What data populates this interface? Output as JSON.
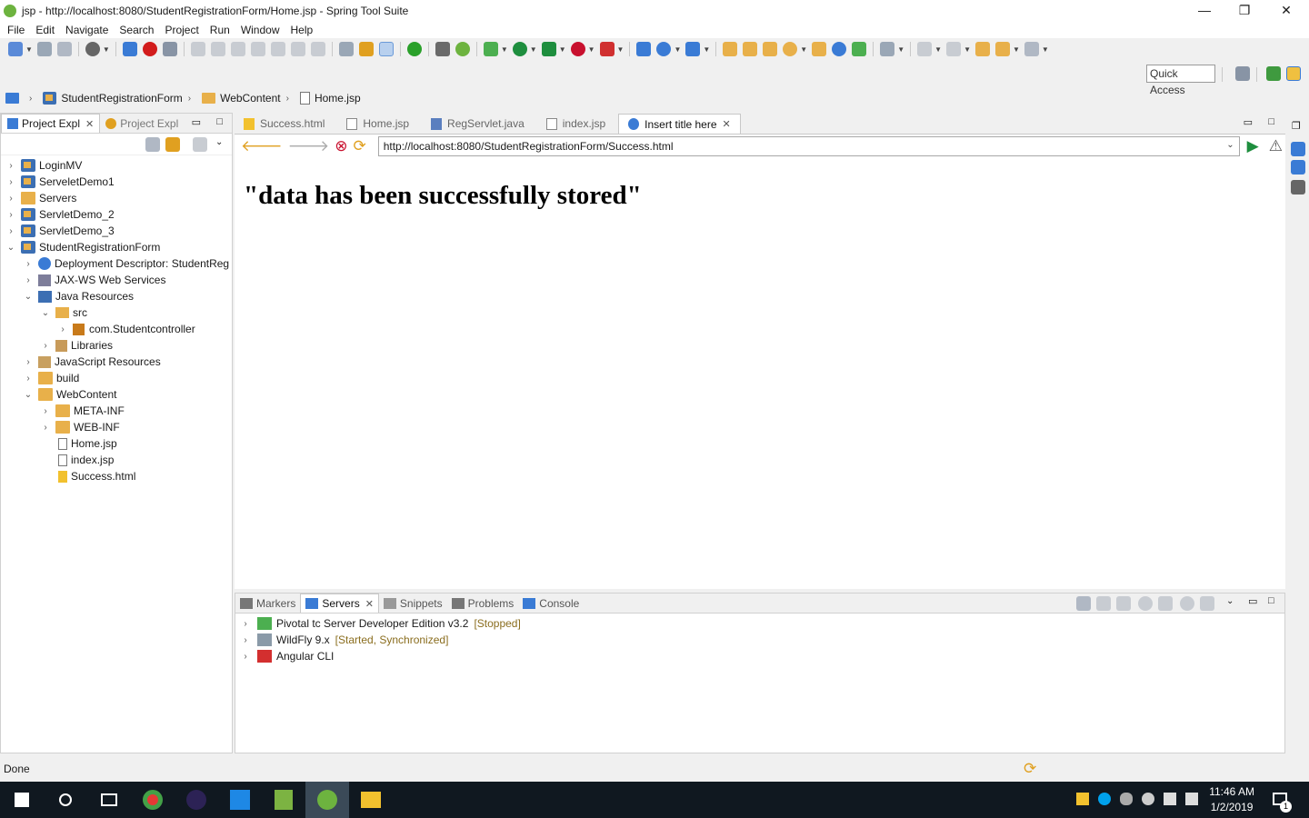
{
  "window": {
    "title": "jsp - http://localhost:8080/StudentRegistrationForm/Home.jsp - Spring Tool Suite",
    "minimize": "—",
    "restore": "❐",
    "close": "✕"
  },
  "menu": [
    "File",
    "Edit",
    "Navigate",
    "Search",
    "Project",
    "Run",
    "Window",
    "Help"
  ],
  "quick_access": "Quick Access",
  "breadcrumb": [
    "StudentRegistrationForm",
    "WebContent",
    "Home.jsp"
  ],
  "left_panel": {
    "tabs": [
      {
        "label": "Project Expl",
        "active": true
      },
      {
        "label": "Project Expl",
        "active": false
      }
    ],
    "tree": [
      {
        "label": "LoginMV",
        "indent": 0,
        "twisty": "›",
        "icon": "proj"
      },
      {
        "label": "ServeletDemo1",
        "indent": 0,
        "twisty": "›",
        "icon": "proj"
      },
      {
        "label": "Servers",
        "indent": 0,
        "twisty": "›",
        "icon": "fold"
      },
      {
        "label": "ServletDemo_2",
        "indent": 0,
        "twisty": "›",
        "icon": "proj"
      },
      {
        "label": "ServletDemo_3",
        "indent": 0,
        "twisty": "›",
        "icon": "proj"
      },
      {
        "label": "StudentRegistrationForm",
        "indent": 0,
        "twisty": "⌄",
        "icon": "proj"
      },
      {
        "label": "Deployment Descriptor: StudentReg",
        "indent": 1,
        "twisty": "›",
        "icon": "globe"
      },
      {
        "label": "JAX-WS Web Services",
        "indent": 1,
        "twisty": "›",
        "icon": "ws"
      },
      {
        "label": "Java Resources",
        "indent": 1,
        "twisty": "⌄",
        "icon": "jres"
      },
      {
        "label": "src",
        "indent": 2,
        "twisty": "⌄",
        "icon": "srcf"
      },
      {
        "label": "com.Studentcontroller",
        "indent": 3,
        "twisty": "›",
        "icon": "pkg"
      },
      {
        "label": "Libraries",
        "indent": 2,
        "twisty": "›",
        "icon": "lib"
      },
      {
        "label": "JavaScript Resources",
        "indent": 1,
        "twisty": "›",
        "icon": "jsr"
      },
      {
        "label": "build",
        "indent": 1,
        "twisty": "›",
        "icon": "fold"
      },
      {
        "label": "WebContent",
        "indent": 1,
        "twisty": "⌄",
        "icon": "fold"
      },
      {
        "label": "META-INF",
        "indent": 2,
        "twisty": "›",
        "icon": "fold"
      },
      {
        "label": "WEB-INF",
        "indent": 2,
        "twisty": "›",
        "icon": "fold"
      },
      {
        "label": "Home.jsp",
        "indent": 2,
        "twisty": "",
        "icon": "jsp"
      },
      {
        "label": "index.jsp",
        "indent": 2,
        "twisty": "",
        "icon": "jsp"
      },
      {
        "label": "Success.html",
        "indent": 2,
        "twisty": "",
        "icon": "html"
      }
    ]
  },
  "editor_tabs": [
    {
      "label": "Success.html",
      "icon": "html",
      "active": false
    },
    {
      "label": "Home.jsp",
      "icon": "jsp",
      "active": false
    },
    {
      "label": "RegServlet.java",
      "icon": "java",
      "active": false
    },
    {
      "label": "index.jsp",
      "icon": "jsp",
      "active": false
    },
    {
      "label": "Insert title here",
      "icon": "globe",
      "active": true
    }
  ],
  "browser": {
    "url": "http://localhost:8080/StudentRegistrationForm/Success.html",
    "page_heading": "\"data has been successfully stored\""
  },
  "bottom_panel": {
    "tabs": [
      {
        "label": "Markers",
        "active": false
      },
      {
        "label": "Servers",
        "active": true
      },
      {
        "label": "Snippets",
        "active": false
      },
      {
        "label": "Problems",
        "active": false
      },
      {
        "label": "Console",
        "active": false
      }
    ],
    "servers": [
      {
        "name": "Pivotal tc Server Developer Edition v3.2",
        "status": "[Stopped]",
        "icon": "pivotal"
      },
      {
        "name": "WildFly  9.x",
        "status": "[Started, Synchronized]",
        "icon": "wildfly"
      },
      {
        "name": "Angular CLI",
        "status": "",
        "icon": "angular"
      }
    ]
  },
  "status_text": "Done",
  "taskbar": {
    "time": "11:46 AM",
    "date": "1/2/2019",
    "notification_count": "1"
  },
  "colors": {
    "accent_blue": "#3a7bd5",
    "spring_green": "#6db33f",
    "folder": "#e8b04a",
    "status_text": "#8a6d1e"
  }
}
